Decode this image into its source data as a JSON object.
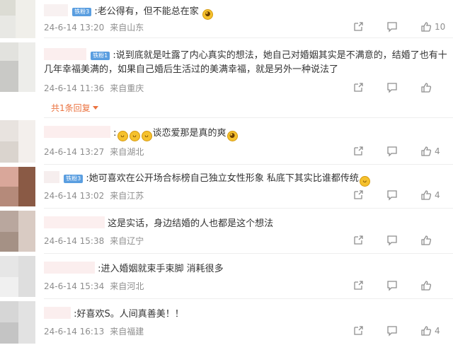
{
  "comments": [
    {
      "badge": "铁粉3",
      "text_before": ":老公得有，但不能总在家",
      "emojis": [],
      "text_after": "",
      "trailing_emoji": "doge-emoji",
      "date": "24-6-14 13:20",
      "location": "来自山东",
      "likes": "10"
    },
    {
      "badge": "铁粉1",
      "text_before": ":说到底就是吐露了内心真实的想法，她自己对婚姻其实是不满意的，结婚了也有十几年幸福美满的，如果自己婚后生活过的美满幸福，就是另外一种说法了",
      "emojis": [],
      "text_after": "",
      "trailing_emoji": "",
      "date": "24-6-14 11:36",
      "location": "来自重庆",
      "likes": "",
      "replies_label": "共1条回复"
    },
    {
      "badge": "",
      "text_before": ":",
      "emojis": [
        "laugh",
        "laugh",
        "laugh"
      ],
      "text_after": "谈恋爱那是真的爽",
      "trailing_emoji": "doge-emoji",
      "date": "24-6-14 13:27",
      "location": "来自湖北",
      "likes": "4"
    },
    {
      "badge": "铁粉3",
      "text_before": ":她可喜欢在公开场合标榜自己独立女性形象 私底下其实比谁都传统",
      "emojis": [],
      "text_after": "",
      "trailing_emoji": "laugh-emoji",
      "date": "24-6-14 13:02",
      "location": "来自江苏",
      "likes": "4"
    },
    {
      "badge": "",
      "text_before": "这是实话，身边结婚的人也都是这个想法",
      "emojis": [],
      "text_after": "",
      "trailing_emoji": "",
      "date": "24-6-14 15:38",
      "location": "来自辽宁",
      "likes": ""
    },
    {
      "badge": "",
      "text_before": ":进入婚姻就束手束脚 消耗很多",
      "emojis": [],
      "text_after": "",
      "trailing_emoji": "",
      "date": "24-6-14 15:34",
      "location": "来自河北",
      "likes": ""
    },
    {
      "badge": "",
      "text_before": ":好喜欢S。人间真善美！！",
      "emojis": [],
      "text_after": "",
      "trailing_emoji": "",
      "date": "24-6-14 16:13",
      "location": "来自福建",
      "likes": "4"
    }
  ],
  "icons": {
    "share": "share-icon",
    "comment": "comment-icon",
    "like": "thumbs-up-icon",
    "doge": "doge-emoji",
    "laugh": "laugh-emoji"
  },
  "colors": {
    "badge_bg": "#5a9ee0",
    "replies_link": "#eb7340",
    "meta_gray": "#8e8e8e",
    "emoji_yellow": "#f5c12e"
  }
}
